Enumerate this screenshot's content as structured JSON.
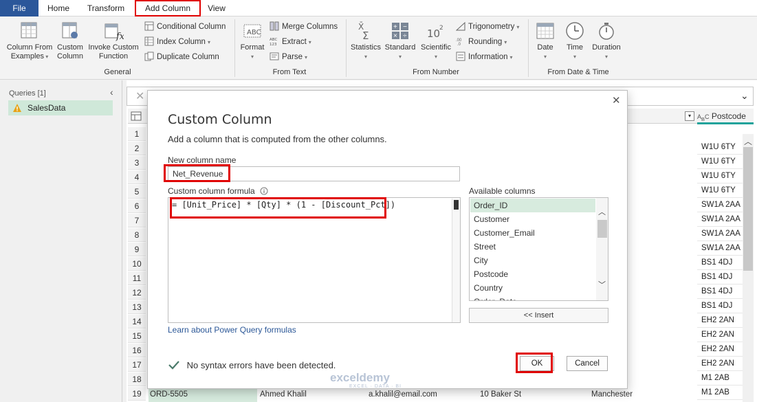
{
  "tabs": {
    "file": "File",
    "home": "Home",
    "transform": "Transform",
    "add_column": "Add Column",
    "view": "View"
  },
  "ribbon": {
    "general": {
      "label": "General",
      "column_from_examples": [
        "Column From",
        "Examples"
      ],
      "custom_column": [
        "Custom",
        "Column"
      ],
      "invoke_custom_function": [
        "Invoke Custom",
        "Function"
      ],
      "conditional_column": "Conditional Column",
      "index_column": "Index Column",
      "duplicate_column": "Duplicate Column"
    },
    "from_text": {
      "label": "From Text",
      "format": "Format",
      "merge_columns": "Merge Columns",
      "extract": "Extract",
      "parse": "Parse"
    },
    "from_number": {
      "label": "From Number",
      "statistics": "Statistics",
      "standard": "Standard",
      "scientific": "Scientific",
      "trigonometry": "Trigonometry",
      "rounding": "Rounding",
      "information": "Information"
    },
    "from_date_time": {
      "label": "From Date & Time",
      "date": "Date",
      "time": "Time",
      "duration": "Duration"
    }
  },
  "queries": {
    "header": "Queries [1]",
    "items": [
      "SalesData"
    ]
  },
  "grid": {
    "postcode_header": "Postcode",
    "row_numbers": [
      "1",
      "2",
      "3",
      "4",
      "5",
      "6",
      "7",
      "8",
      "9",
      "10",
      "11",
      "12",
      "13",
      "14",
      "15",
      "16",
      "17",
      "18",
      "19"
    ],
    "postcodes": [
      "W1U 6TY",
      "W1U 6TY",
      "W1U 6TY",
      "W1U 6TY",
      "SW1A 2AA",
      "SW1A 2AA",
      "SW1A 2AA",
      "SW1A 2AA",
      "BS1 4DJ",
      "BS1 4DJ",
      "BS1 4DJ",
      "BS1 4DJ",
      "EH2 2AN",
      "EH2 2AN",
      "EH2 2AN",
      "EH2 2AN",
      "M1 2AB",
      "M1 2AB",
      "M1 2AB"
    ],
    "row19": {
      "order_id": "ORD-5505",
      "customer": "Ahmed Khalil",
      "email": "a.khalil@email.com",
      "street": "10 Baker St",
      "city": "Manchester"
    }
  },
  "dialog": {
    "title": "Custom Column",
    "description": "Add a column that is computed from the other columns.",
    "new_column_label": "New column name",
    "new_column_value": "Net_Revenue",
    "formula_label": "Custom column formula",
    "formula_value": "= [Unit_Price] * [Qty] * (1 - [Discount_Pct])",
    "available_label": "Available columns",
    "available_columns": [
      "Order_ID",
      "Customer",
      "Customer_Email",
      "Street",
      "City",
      "Postcode",
      "Country",
      "Order_Date"
    ],
    "selected_column": "Order_ID",
    "insert_button": "<< Insert",
    "learn_link": "Learn about Power Query formulas",
    "status": "No syntax errors have been detected.",
    "ok_button": "OK",
    "cancel_button": "Cancel"
  },
  "watermark": {
    "name": "exceldemy",
    "tagline": "EXCEL · DATA · BI"
  },
  "colors": {
    "accent_blue": "#2b579a",
    "highlight_red": "#e00000",
    "selected_green": "#d7ebde",
    "link_blue": "#2b5797"
  }
}
